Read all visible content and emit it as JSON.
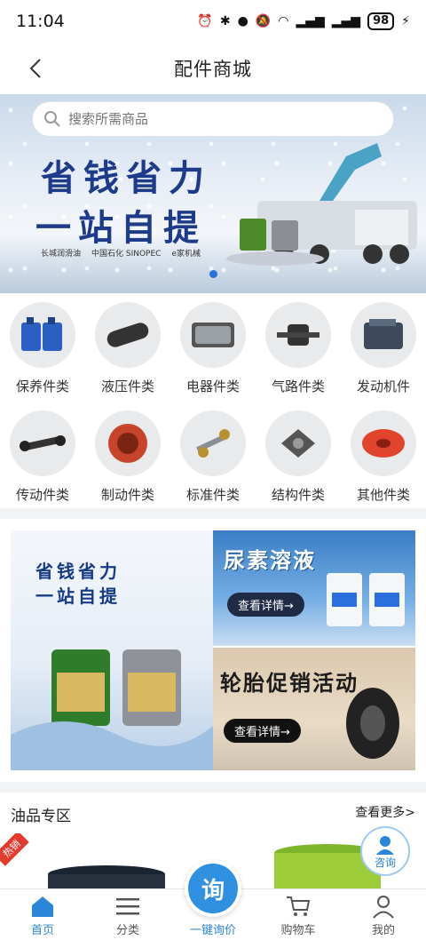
{
  "status_bar": {
    "time": "11:04",
    "battery": "98"
  },
  "nav": {
    "title": "配件商城"
  },
  "search": {
    "placeholder": "搜索所需商品"
  },
  "banner": {
    "line1": "省钱省力",
    "line2": "一站自提",
    "logos": [
      "长城润滑油",
      "中国石化 SINOPEC",
      "e家机械"
    ]
  },
  "categories": [
    {
      "label": "保养件类",
      "icon": "oil-bottles-icon"
    },
    {
      "label": "液压件类",
      "icon": "hydraulic-cylinder-icon"
    },
    {
      "label": "电器件类",
      "icon": "headlight-icon"
    },
    {
      "label": "气路件类",
      "icon": "air-valve-icon"
    },
    {
      "label": "发动机件",
      "icon": "engine-icon"
    },
    {
      "label": "传动件类",
      "icon": "drive-shaft-icon"
    },
    {
      "label": "制动件类",
      "icon": "brake-drum-icon"
    },
    {
      "label": "标准件类",
      "icon": "bolt-icon"
    },
    {
      "label": "结构件类",
      "icon": "bracket-icon"
    },
    {
      "label": "其他件类",
      "icon": "pulley-icon"
    }
  ],
  "promos": {
    "left": {
      "line1": "省钱省力",
      "line2": "一站自提"
    },
    "right_top": {
      "title": "尿素溶液",
      "button": "查看详情→"
    },
    "right_bottom": {
      "title": "轮胎促销活动",
      "button": "查看详情→"
    }
  },
  "oil_section": {
    "title": "油品专区",
    "more": "查看更多>",
    "ribbon": "热销"
  },
  "consult": {
    "label": "咨询"
  },
  "tab_bar": {
    "items": [
      {
        "label": "首页",
        "icon": "home-icon",
        "active": true
      },
      {
        "label": "分类",
        "icon": "list-icon",
        "active": false
      },
      {
        "label": "一键询价",
        "icon": "inquiry-icon",
        "active": false
      },
      {
        "label": "购物车",
        "icon": "cart-icon",
        "active": false
      },
      {
        "label": "我的",
        "icon": "user-icon",
        "active": false
      }
    ],
    "fab_label": "询"
  },
  "colors": {
    "accent": "#2a86d8",
    "banner_text": "#1e3a8a"
  }
}
